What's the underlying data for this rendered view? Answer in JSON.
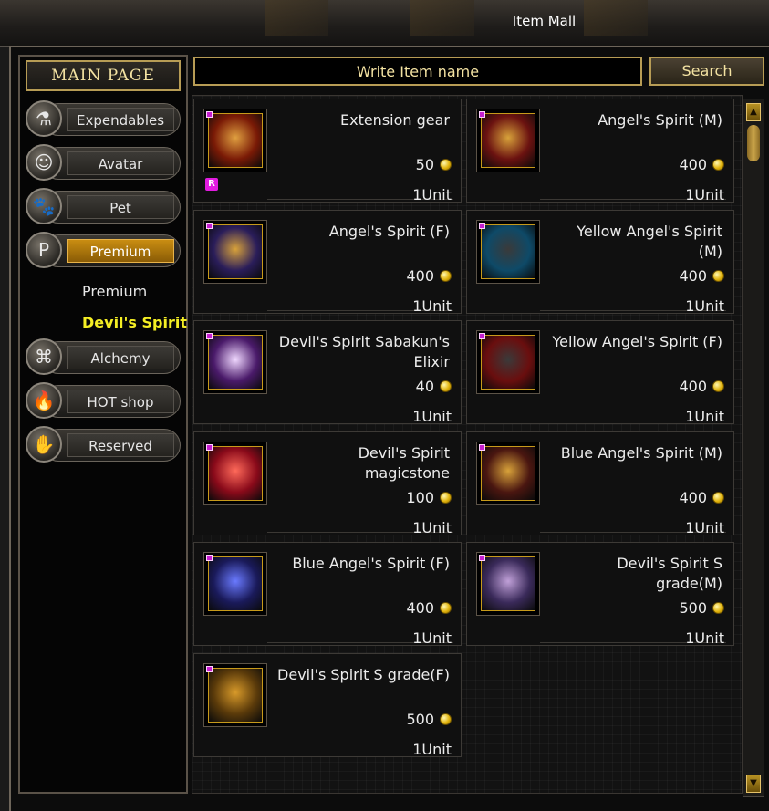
{
  "window": {
    "title": "Item Mall"
  },
  "nav": {
    "main_page": "MAIN PAGE",
    "categories": [
      {
        "label": "Expendables",
        "icon": "potion-icon",
        "glyph": "⚗"
      },
      {
        "label": "Avatar",
        "icon": "avatar-face-icon",
        "glyph": "☺"
      },
      {
        "label": "Pet",
        "icon": "pet-icon",
        "glyph": "🐾"
      },
      {
        "label": "Premium",
        "icon": "premium-p-icon",
        "glyph": "P"
      },
      {
        "label": "Alchemy",
        "icon": "alchemy-icon",
        "glyph": "⌘"
      },
      {
        "label": "HOT shop",
        "icon": "fire-icon",
        "glyph": "🔥"
      },
      {
        "label": "Reserved",
        "icon": "reserved-icon",
        "glyph": "✋"
      }
    ],
    "subcategories": [
      "Premium",
      "Devil's Spirit"
    ]
  },
  "search": {
    "placeholder": "Write Item name",
    "button": "Search"
  },
  "items": [
    {
      "name": "Extension gear",
      "price": "50",
      "unit": "1Unit",
      "badge": "R",
      "colors": [
        "#7a1a06",
        "#e0a040"
      ]
    },
    {
      "name": "Angel's Spirit (M)",
      "price": "400",
      "unit": "1Unit",
      "colors": [
        "#6b1210",
        "#d8a23a"
      ]
    },
    {
      "name": "Angel's Spirit (F)",
      "price": "400",
      "unit": "1Unit",
      "colors": [
        "#2a1d5a",
        "#d8a23a"
      ]
    },
    {
      "name": "Yellow Angel's Spirit (M)",
      "price": "400",
      "unit": "1Unit",
      "colors": [
        "#0e4a68",
        "#3a3a3a"
      ]
    },
    {
      "name": "Devil's Spirit Sabakun's Elixir",
      "price": "40",
      "unit": "1Unit",
      "colors": [
        "#4a1a6a",
        "#f0d8ff"
      ]
    },
    {
      "name": "Yellow Angel's Spirit (F)",
      "price": "400",
      "unit": "1Unit",
      "colors": [
        "#6a0e0e",
        "#3a3a3a"
      ]
    },
    {
      "name": "Devil's Spirit magicstone",
      "price": "100",
      "unit": "1Unit",
      "colors": [
        "#8a0a1a",
        "#ff6a5a"
      ]
    },
    {
      "name": "Blue Angel's Spirit (M)",
      "price": "400",
      "unit": "1Unit",
      "colors": [
        "#4a1610",
        "#d8a23a"
      ]
    },
    {
      "name": "Blue Angel's Spirit (F)",
      "price": "400",
      "unit": "1Unit",
      "colors": [
        "#1a1a5a",
        "#6a7aff"
      ]
    },
    {
      "name": "Devil's Spirit S grade(M)",
      "price": "500",
      "unit": "1Unit",
      "colors": [
        "#3a2a5a",
        "#c0a0d8"
      ]
    },
    {
      "name": "Devil's Spirit S grade(F)",
      "price": "500",
      "unit": "1Unit",
      "colors": [
        "#5a3a0a",
        "#d89a2a"
      ]
    }
  ],
  "colors": {
    "accent_gold": "#b79c55",
    "active_tab": "#c98d12",
    "current_sub": "#f4ee24"
  }
}
